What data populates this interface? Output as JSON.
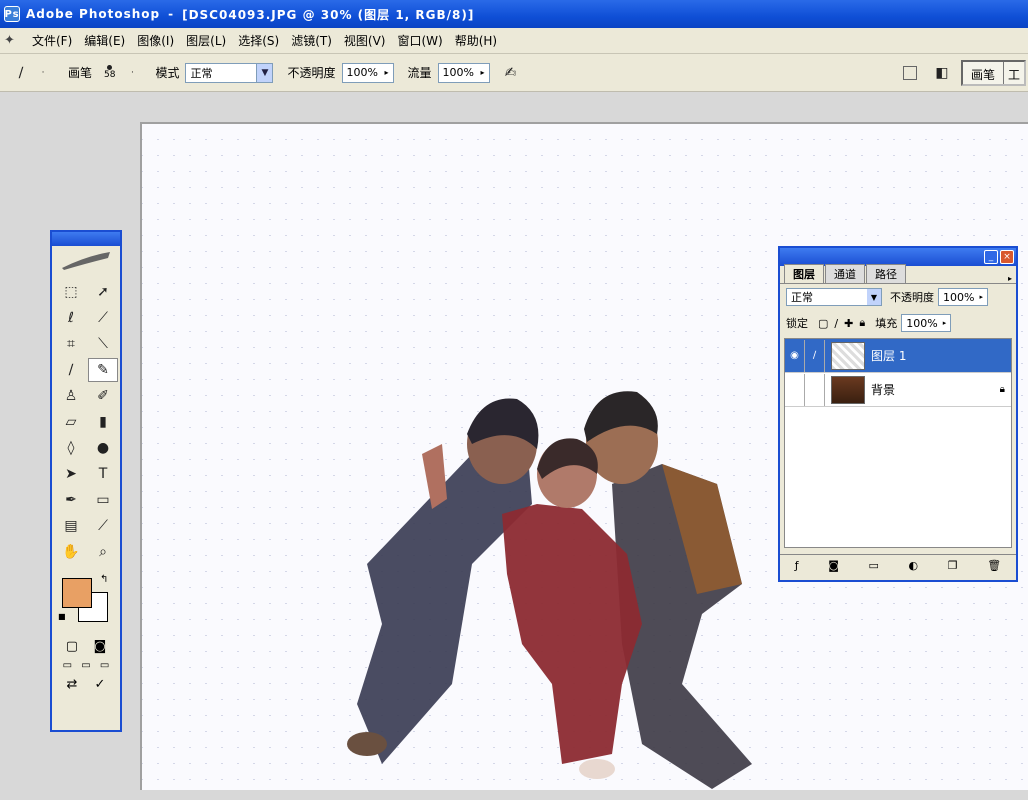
{
  "window": {
    "app_name": "Adobe Photoshop",
    "document": "[DSC04093.JPG @ 30% (图层 1, RGB/8)]"
  },
  "menu": {
    "items": [
      "文件(F)",
      "编辑(E)",
      "图像(I)",
      "图层(L)",
      "选择(S)",
      "滤镜(T)",
      "视图(V)",
      "窗口(W)",
      "帮助(H)"
    ]
  },
  "options": {
    "brush_label": "画笔",
    "brush_size": "58",
    "mode_label": "模式",
    "mode_value": "正常",
    "opacity_label": "不透明度",
    "opacity_value": "100%",
    "flow_label": "流量",
    "flow_value": "100%",
    "palette_well_label": "画笔",
    "palette_well_label2": "工"
  },
  "layers_panel": {
    "tabs": [
      "图层",
      "通道",
      "路径"
    ],
    "blend_mode": "正常",
    "opacity_label": "不透明度",
    "opacity_value": "100%",
    "lock_label": "锁定",
    "fill_label": "填充",
    "fill_value": "100%",
    "layers": [
      {
        "name": "图层 1",
        "selected": true,
        "visible": true
      },
      {
        "name": "背景",
        "selected": false,
        "visible": false,
        "locked": true
      }
    ]
  },
  "colors": {
    "accent": "#1a4dd2",
    "foreground": "#e8a064",
    "background": "#ffffff",
    "selected_layer": "#3169c6"
  }
}
